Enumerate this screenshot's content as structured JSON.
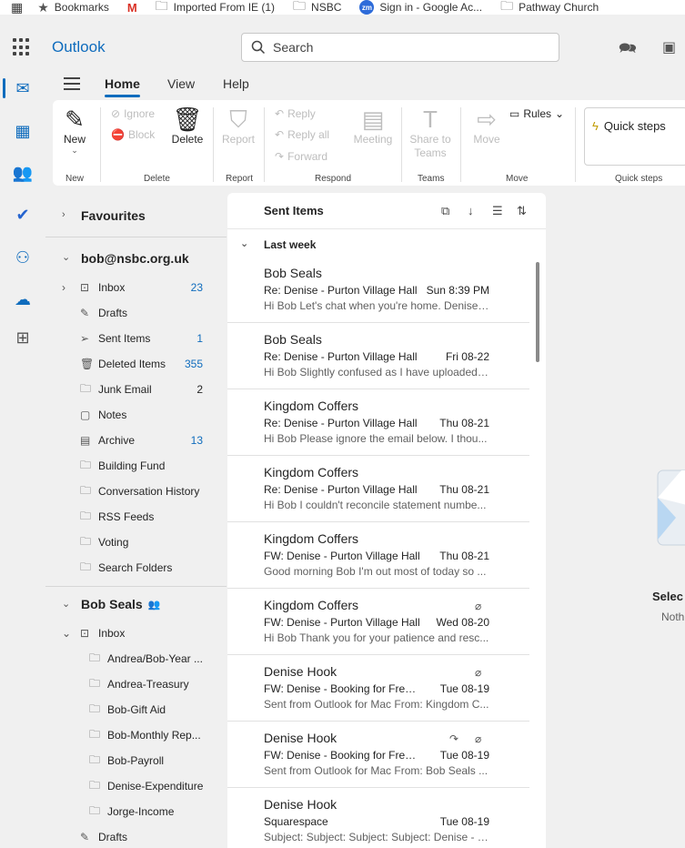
{
  "bookmarks": [
    {
      "label": "Bookmarks",
      "icon": "star-icon"
    },
    {
      "label": "",
      "icon": "gmail-icon"
    },
    {
      "label": "Imported From IE (1)",
      "icon": "folder-icon"
    },
    {
      "label": "NSBC",
      "icon": "folder-icon"
    },
    {
      "label": "Sign in - Google Ac...",
      "icon": "zoom-icon"
    },
    {
      "label": "Pathway Church",
      "icon": "folder-icon"
    }
  ],
  "header": {
    "brand": "Outlook",
    "search_placeholder": "Search"
  },
  "ribbon": {
    "tabs": [
      "Home",
      "View",
      "Help"
    ],
    "active_tab": "Home",
    "new_label": "New",
    "ignore_label": "Ignore",
    "block_label": "Block",
    "delete_label": "Delete",
    "report_label": "Report",
    "reply_label": "Reply",
    "reply_all_label": "Reply all",
    "forward_label": "Forward",
    "meeting_label": "Meeting",
    "share_to_teams_label": "Share to Teams",
    "move_label": "Move",
    "rules_label": "Rules",
    "quick_steps_label": "Quick steps",
    "groups": [
      "New",
      "Delete",
      "Report",
      "Respond",
      "Teams",
      "Move",
      "Quick steps"
    ]
  },
  "folders": {
    "favourites": "Favourites",
    "account": "bob@nsbc.org.uk",
    "account_items": [
      {
        "label": "Inbox",
        "count": "23",
        "icon": "inbox-icon"
      },
      {
        "label": "Drafts",
        "count": "",
        "icon": "pencil-icon"
      },
      {
        "label": "Sent Items",
        "count": "1",
        "icon": "send-icon"
      },
      {
        "label": "Deleted Items",
        "count": "355",
        "icon": "trash-icon"
      },
      {
        "label": "Junk Email",
        "count": "2",
        "icon": "junk-icon"
      },
      {
        "label": "Notes",
        "count": "",
        "icon": "note-icon"
      },
      {
        "label": "Archive",
        "count": "13",
        "icon": "archive-icon"
      },
      {
        "label": "Building Fund",
        "count": "",
        "icon": "folder-icon"
      },
      {
        "label": "Conversation History",
        "count": "",
        "icon": "folder-icon"
      },
      {
        "label": "RSS Feeds",
        "count": "",
        "icon": "folder-icon"
      },
      {
        "label": "Voting",
        "count": "",
        "icon": "folder-icon"
      },
      {
        "label": "Search Folders",
        "count": "",
        "icon": "search-folder-icon"
      }
    ],
    "shared": "Bob Seals",
    "shared_inbox": "Inbox",
    "shared_subfolders": [
      "Andrea/Bob-Year ...",
      "Andrea-Treasury",
      "Bob-Gift Aid",
      "Bob-Monthly Rep...",
      "Bob-Payroll",
      "Denise-Expenditure",
      "Jorge-Income"
    ],
    "shared_drafts": "Drafts"
  },
  "message_list": {
    "title": "Sent Items",
    "group": "Last week",
    "messages": [
      {
        "sender": "Bob Seals",
        "subject": "Re: Denise - Purton Village Hall",
        "date": "Sun 8:39 PM",
        "preview": "Hi Bob Let's chat when you're home. Denise ...",
        "attachment": false,
        "forwarded": false
      },
      {
        "sender": "Bob Seals",
        "subject": "Re: Denise - Purton Village Hall",
        "date": "Fri 08-22",
        "preview": "Hi Bob Slightly confused as I have uploaded ...",
        "attachment": false,
        "forwarded": false
      },
      {
        "sender": "Kingdom Coffers",
        "subject": "Re: Denise - Purton Village Hall",
        "date": "Thu 08-21",
        "preview": "Hi Bob Please ignore the email below. I thou...",
        "attachment": false,
        "forwarded": false
      },
      {
        "sender": "Kingdom Coffers",
        "subject": "Re: Denise - Purton Village Hall",
        "date": "Thu 08-21",
        "preview": "Hi Bob I couldn't reconcile statement numbe...",
        "attachment": false,
        "forwarded": false
      },
      {
        "sender": "Kingdom Coffers",
        "subject": "FW: Denise - Purton Village Hall",
        "date": "Thu 08-21",
        "preview": "Good morning Bob I'm out most of today so ...",
        "attachment": false,
        "forwarded": false
      },
      {
        "sender": "Kingdom Coffers",
        "subject": "FW: Denise - Purton Village Hall",
        "date": "Wed 08-20",
        "preview": "Hi Bob Thank you for your patience and resc...",
        "attachment": true,
        "forwarded": false
      },
      {
        "sender": "Denise Hook",
        "subject": "FW: Denise - Booking for Fresh...",
        "date": "Tue 08-19",
        "preview": "Sent from Outlook for Mac From: Kingdom C...",
        "attachment": true,
        "forwarded": false
      },
      {
        "sender": "Denise Hook",
        "subject": "FW: Denise - Booking for Fresh...",
        "date": "Tue 08-19",
        "preview": "Sent from Outlook for Mac From: Bob Seals ...",
        "attachment": true,
        "forwarded": true
      },
      {
        "sender": "Denise Hook",
        "subject": "Squarespace",
        "date": "Tue 08-19",
        "preview": "Subject: Subject: Subject: Subject: Denise - F...",
        "attachment": false,
        "forwarded": false
      }
    ]
  },
  "reading_pane": {
    "line1": "Selec",
    "line2": "Noth"
  },
  "colors": {
    "accent": "#0f6cbd",
    "background": "#f0f0f0"
  }
}
